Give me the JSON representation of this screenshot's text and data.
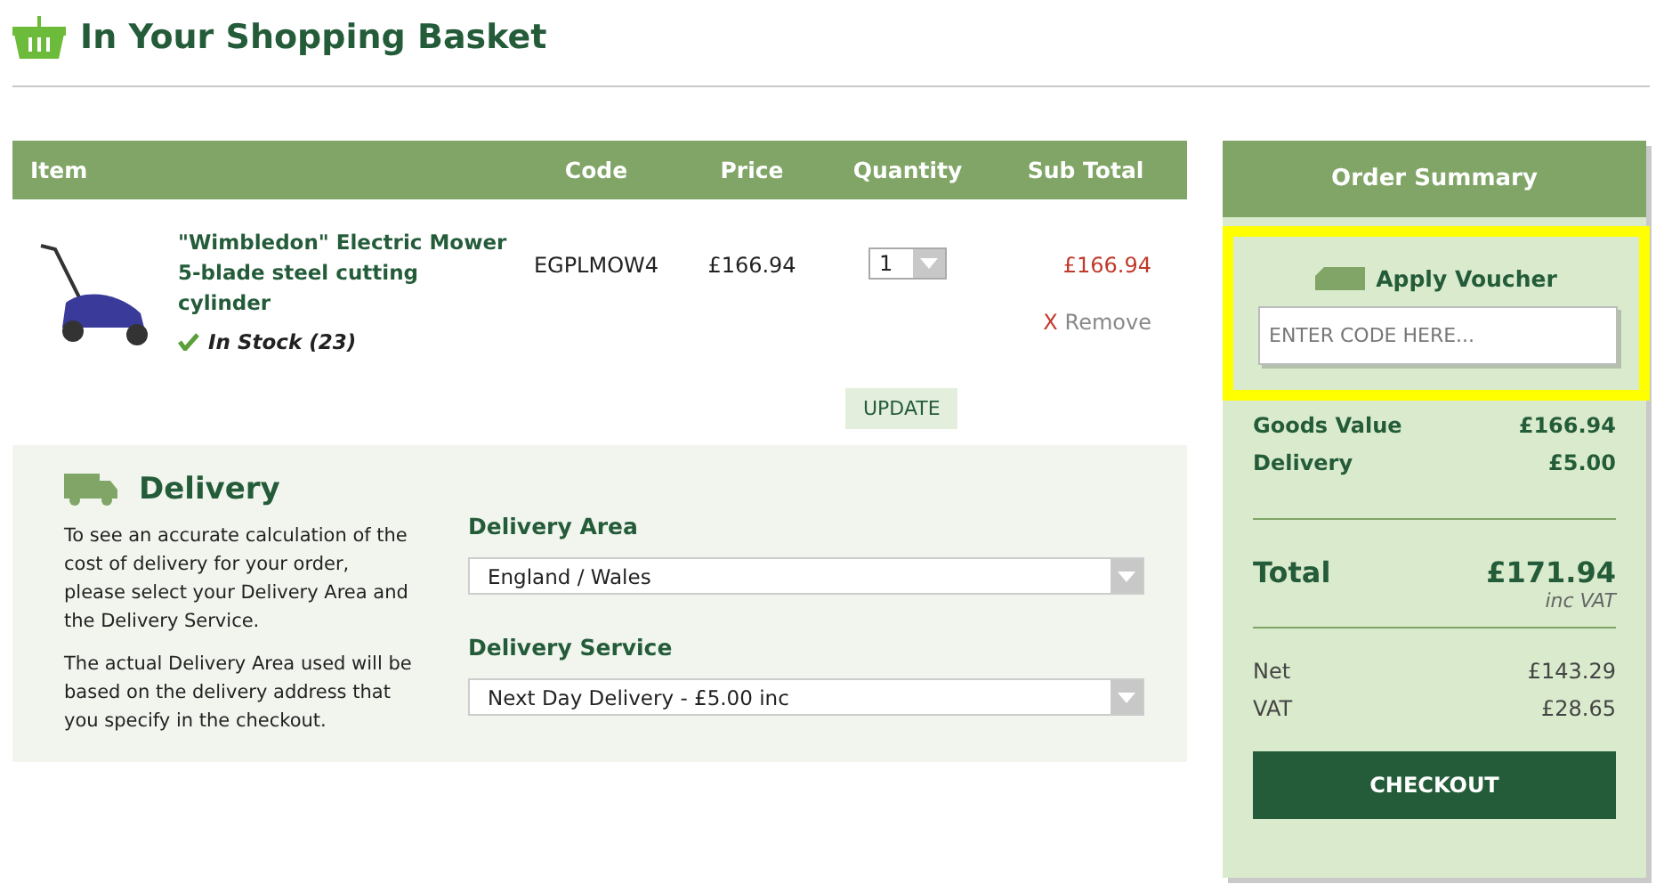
{
  "page_title": "In Your Shopping Basket",
  "basket": {
    "columns": [
      "Item",
      "Code",
      "Price",
      "Quantity",
      "Sub Total"
    ],
    "rows": [
      {
        "name": "\"Wimbledon\" Electric Mower 5-blade steel cutting cylinder",
        "in_stock": true,
        "stock_text": "In Stock (23)",
        "code": "EGPLMOW4",
        "price": "£166.94",
        "quantity": "1",
        "sub_total": "£166.94",
        "remove_icon": "X",
        "remove": "Remove"
      }
    ],
    "update_button": "UPDATE"
  },
  "delivery": {
    "title": "Delivery",
    "paragraphs": [
      "To see an accurate calculation of the cost of delivery for your order, please select your Delivery Area and the Delivery Service.",
      "The actual Delivery Area used will be based on the delivery address that you specify in the checkout."
    ],
    "fields": [
      {
        "label": "Delivery Area",
        "value": "England / Wales"
      },
      {
        "label": "Delivery Service",
        "value": "Next Day Delivery - £5.00 inc"
      }
    ]
  },
  "summary": {
    "title": "Order Summary",
    "voucher": {
      "title": "Apply Voucher",
      "placeholder": "ENTER CODE HERE...",
      "highlighted": true
    },
    "lines": [
      {
        "label": "Goods Value",
        "value": "£166.94"
      },
      {
        "label": "Delivery",
        "value": "£5.00"
      }
    ],
    "total": {
      "label": "Total",
      "value": "£171.94",
      "note": "inc VAT"
    },
    "tax_lines": [
      {
        "label": "Net",
        "value": "£143.29"
      },
      {
        "label": "VAT",
        "value": "£28.65"
      }
    ],
    "checkout_button": "CHECKOUT"
  }
}
